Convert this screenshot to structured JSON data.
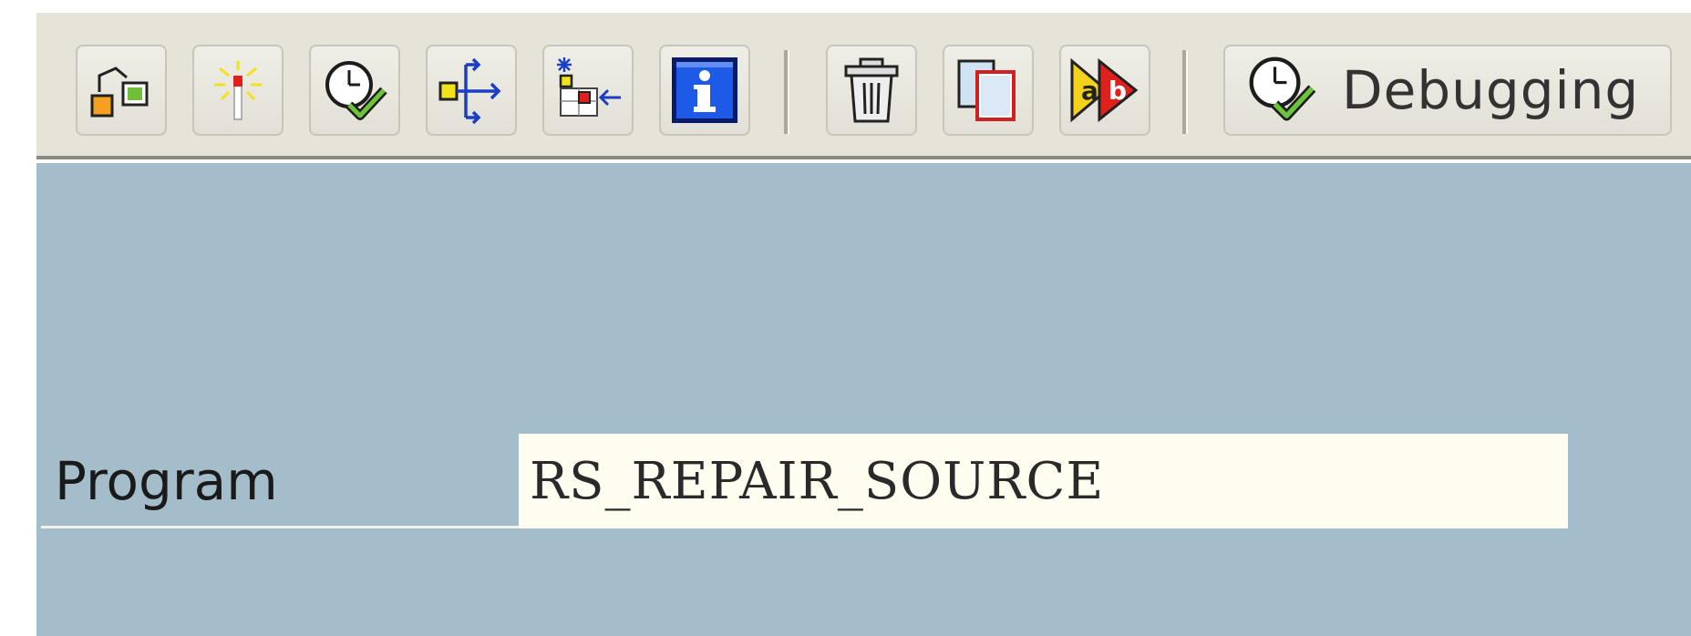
{
  "toolbar": {
    "buttons": [
      {
        "icon": "hierarchy-icon"
      },
      {
        "icon": "magic-wand-icon"
      },
      {
        "icon": "clock-check-icon"
      },
      {
        "icon": "where-used-icon"
      },
      {
        "icon": "object-list-icon"
      },
      {
        "icon": "info-icon"
      },
      {
        "icon": "trash-icon"
      },
      {
        "icon": "copy-icon"
      },
      {
        "icon": "compare-ab-icon"
      }
    ],
    "debugging_label": "Debugging",
    "debugging_icon": "clock-check-icon"
  },
  "form": {
    "program_label": "Program",
    "program_value": "RS_REPAIR_SOURCE"
  },
  "colors": {
    "toolbar_bg": "#e6e4d9",
    "content_bg": "#a3bdca",
    "input_bg": "#fffdf0"
  }
}
